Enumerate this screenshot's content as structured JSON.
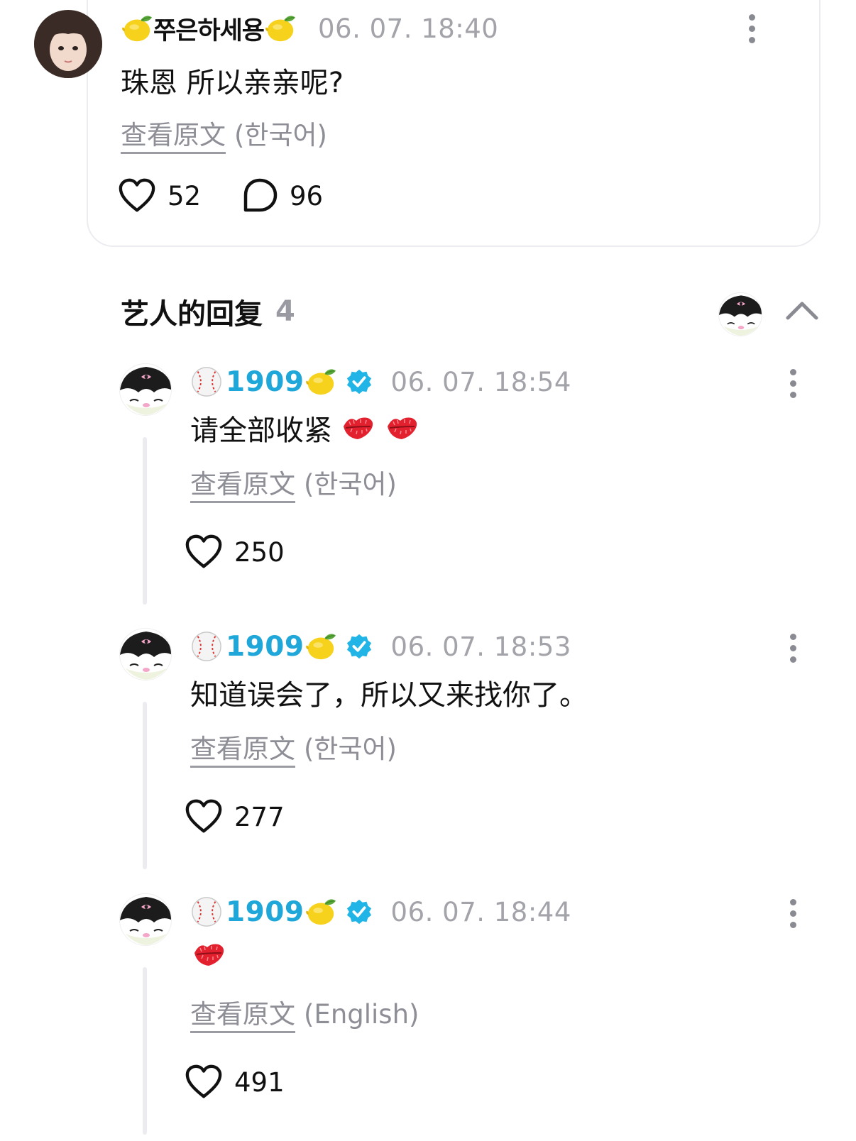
{
  "post": {
    "author": "쭈은하세용",
    "timestamp": "06. 07. 18:40",
    "message": "珠恩 所以亲亲呢?",
    "view_original": "查看原文",
    "original_lang": "(한국어)",
    "likes": "52",
    "comments": "96"
  },
  "artist_replies": {
    "title": "艺人的回复",
    "count": "4"
  },
  "replies": [
    {
      "author": "1909",
      "timestamp": "06. 07. 18:54",
      "message": "请全部收紧",
      "emoji": [
        "kiss-mark-icon",
        "kiss-mark-icon"
      ],
      "view_original": "查看原文",
      "original_lang": "(한국어)",
      "likes": "250"
    },
    {
      "author": "1909",
      "timestamp": "06. 07. 18:53",
      "message": "知道误会了，所以又来找你了。",
      "emoji": [],
      "view_original": "查看原文",
      "original_lang": "(한국어)",
      "likes": "277"
    },
    {
      "author": "1909",
      "timestamp": "06. 07. 18:44",
      "message": "",
      "emoji": [
        "kiss-mark-icon"
      ],
      "view_original": "查看原文",
      "original_lang": "(English)",
      "likes": "491"
    }
  ],
  "colors": {
    "artist_name": "#1ea7d8",
    "verified_badge": "#20b5e6",
    "muted_text": "#8e8e96",
    "timestamp": "#a3a3aa",
    "divider": "#ececf0"
  }
}
